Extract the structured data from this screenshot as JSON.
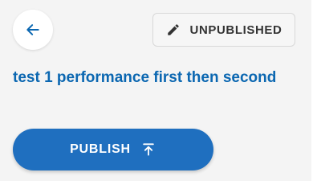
{
  "colors": {
    "panel_background": "#f4f4f4",
    "accent": "#0b67b1",
    "publish_button": "#1f6fbf",
    "status_text": "#333333"
  },
  "header": {
    "back_icon": "arrow-left-icon",
    "status_button": {
      "icon": "pencil-icon",
      "label": "UNPUBLISHED"
    }
  },
  "content": {
    "title": "test 1 performance first then second"
  },
  "actions": {
    "publish_button": {
      "label": "PUBLISH",
      "icon": "upload-arrow-icon"
    }
  }
}
